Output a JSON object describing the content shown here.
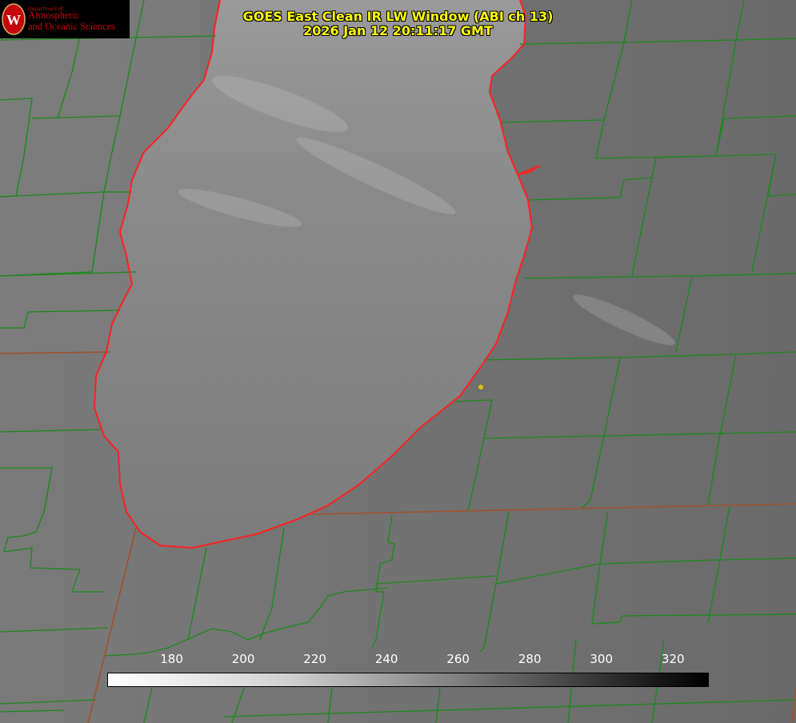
{
  "title": {
    "line1": "GOES East Clean IR LW Window (ABI ch 13)",
    "line2": "2026 Jan 12 20:11:17 GMT"
  },
  "logo": {
    "dept": "Department of",
    "line1": "Atmospheric",
    "line2": "and Oceanic Sciences"
  },
  "colorbar": {
    "ticks": [
      "180",
      "200",
      "220",
      "240",
      "260",
      "280",
      "300",
      "320"
    ],
    "range": [
      162,
      330
    ],
    "colormap": "white-to-black"
  },
  "colors": {
    "lake": "#7d7d7d",
    "land": "#6f6f6f",
    "county_lines": "#1a8a1a",
    "shoreline": "#ff2020",
    "title": "#ffff00",
    "marker": "#d7c400"
  },
  "marker": {
    "type": "yellow-dot"
  }
}
